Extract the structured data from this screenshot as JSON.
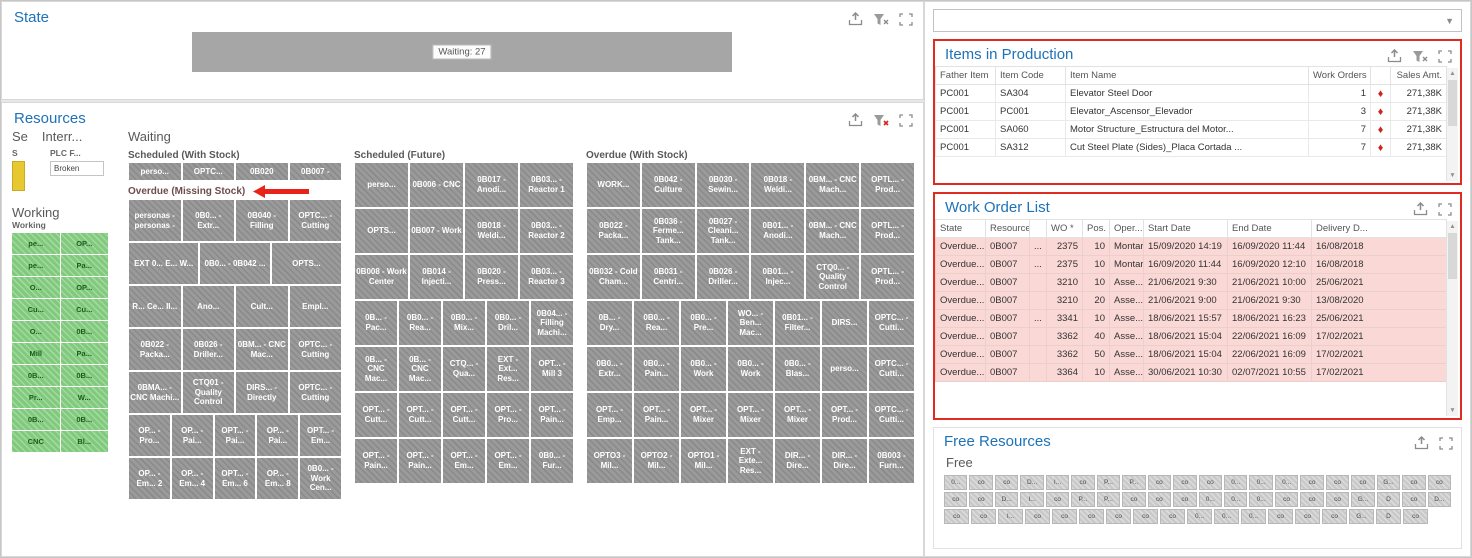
{
  "icons": {
    "export": "export-icon",
    "clear_filter": "clear-filter-icon",
    "maximize": "maximize-icon",
    "dropdown_caret": "chevron-down-icon",
    "diamond": "diamond-icon",
    "annotation_arrow": "red-arrow-icon",
    "scroll_up": "scroll-up-icon",
    "scroll_down": "scroll-down-icon"
  },
  "colors": {
    "title_blue": "#1d72b8",
    "highlight_red": "#e02b20",
    "tile_gray": "#9a9a9a",
    "tile_green": "#7fca7c",
    "tile_green_text": "#1f5c1f",
    "row_pink": "#f9d8d6",
    "diamond_red": "#cf2518",
    "bar_gray": "#a6a6a6",
    "broken_yellow": "#e5c832",
    "free_tile_gray": "#c9c9c9",
    "arrow_red": "#e8241a",
    "overdue_header": "#6d4c4c"
  },
  "state_panel": {
    "title": "State",
    "bar_label": "Waiting: 27"
  },
  "resources_panel": {
    "title": "Resources",
    "sections": {
      "setup": "Se",
      "interrupted": "Interr...",
      "waiting": "Waiting",
      "working": "Working"
    },
    "setup_group": {
      "header": "S"
    },
    "interrupted_group": {
      "header": "PLC F...",
      "tile": "Broken"
    },
    "working_group": {
      "header": "Working",
      "rows": [
        [
          "pe...",
          "OP..."
        ],
        [
          "pe...",
          "Pa..."
        ],
        [
          "O...",
          "OP..."
        ],
        [
          "Cu...",
          "Cu..."
        ],
        [
          "O...",
          "0B..."
        ],
        [
          "Mill",
          "Pa..."
        ],
        [
          "0B...",
          "0B..."
        ],
        [
          "Pr...",
          "W..."
        ],
        [
          "0B...",
          "0B..."
        ],
        [
          "CNC",
          "Bl..."
        ]
      ]
    },
    "groups": [
      {
        "name": "Scheduled (With Stock)",
        "col": 0,
        "rows": [
          [
            "perso...",
            "OPTC...",
            "0B020",
            "0B007 -"
          ]
        ]
      },
      {
        "name": "Overdue (Missing Stock)",
        "col": 0,
        "arrow": true,
        "rows": [
          [
            "personas - personas -",
            "0B0... - Extr...",
            "0B040 - Filling",
            "OPTC... - Cutting"
          ],
          [
            "EXT 0... E... W...",
            "0B0... - 0B042 ...",
            "OPTS..."
          ],
          [
            "R... Ce... II...",
            "Ano...",
            "Cult...",
            "Empl..."
          ],
          [
            "0B022 - Packa...",
            "0B026 - Driller...",
            "0BM... - CNC Mac...",
            "OPTC... - Cutting"
          ],
          [
            "0BMA... - CNC Machi...",
            "CTQ01 - Quality Control",
            "DIRS... - Directly",
            "OPTC... - Cutting"
          ],
          [
            "OP... - Pro...",
            "OP... - Pai...",
            "OPT... - Pai...",
            "OP... - Pai...",
            "OPT... - Em..."
          ],
          [
            "OP... - Em... 2",
            "OP... - Em... 4",
            "OPT... - Em... 6",
            "OP... - Em... 8",
            "0B0... - Work Cen..."
          ]
        ]
      },
      {
        "name": "Scheduled (Future)",
        "col": 1,
        "rows": [
          [
            "perso...",
            "0B006 - CNC",
            "0B017 - Anodi...",
            "0B03... - Reactor 1"
          ],
          [
            "OPTS...",
            "0B007 - Work",
            "0B018 - Weldi...",
            "0B03... - Reactor 2"
          ],
          [
            "0B008 - Work Center",
            "0B014 - Injecti...",
            "0B020 - Press...",
            "0B03... - Reactor 3"
          ],
          [
            "0B... - Pac...",
            "0B0... - Rea...",
            "0B0... - Mix...",
            "0B0... - Dril...",
            "0B04... - Filling Machi..."
          ],
          [
            "0B... - CNC Mac...",
            "0B... - CNC Mac...",
            "CTQ... - Qua...",
            "EXT - Ext... Res...",
            "OPT... - Mill 3"
          ],
          [
            "OPT... - Cutt...",
            "OPT... - Cutt...",
            "OPT... - Cutt...",
            "OPT... - Pro...",
            "OPT... - Pain..."
          ],
          [
            "OPT... - Pain...",
            "OPT... - Pain...",
            "OPT... - Em...",
            "OPT... - Em...",
            "0B0... - Fur..."
          ]
        ]
      },
      {
        "name": "Overdue (With Stock)",
        "col": 2,
        "rows": [
          [
            "WORK...",
            "0B042 - Culture",
            "0B030 - Sewin...",
            "0B018 - Weldi...",
            "0BM... - CNC Mach...",
            "OPTL... - Prod..."
          ],
          [
            "0B022 - Packa...",
            "0B036 - Ferme... Tank...",
            "0B027 - Cleani... Tank...",
            "0B01... - Anodi...",
            "0BM... - CNC Mach...",
            "OPTL... - Prod..."
          ],
          [
            "0B032 - Cold Cham...",
            "0B031 - Centri...",
            "0B026 - Driller...",
            "0B01... - Injec...",
            "CTQ0... - Quality Control",
            "OPTL... - Prod..."
          ],
          [
            "0B... - Dry...",
            "0B0... - Rea...",
            "0B0... - Pre...",
            "WO... - Ben... Mac...",
            "0B01... - Filter...",
            "DIRS...",
            "OPTC... - Cutti..."
          ],
          [
            "0B0... - Extr...",
            "0B0... - Pain...",
            "0B0... - Work",
            "0B0... - Work",
            "0B0... - Blas...",
            "perso...",
            "OPTC... - Cutti..."
          ],
          [
            "OPT... - Emp...",
            "OPT... - Pain...",
            "OPT... - Mixer",
            "OPT... - Mixer",
            "OPT... - Mixer",
            "OPT... - Prod...",
            "OPTC... - Cutti..."
          ],
          [
            "OPTO3 - Mil...",
            "OPTO2 - Mil...",
            "OPTO1 - Mil...",
            "EXT - Exte... Res...",
            "DIR... - Dire...",
            "DIR... - Dire...",
            "0B003 - Furn..."
          ]
        ]
      }
    ]
  },
  "filter_combo": {
    "value": ""
  },
  "items_panel": {
    "title": "Items in Production",
    "columns": [
      "Father Item",
      "Item Code",
      "Item Name",
      "Work Orders",
      "",
      "Sales Amt."
    ],
    "rows": [
      [
        "PC001",
        "SA304",
        "Elevator Steel Door",
        "1",
        "♦",
        "271,38K"
      ],
      [
        "PC001",
        "PC001",
        "Elevator_Ascensor_Elevador",
        "3",
        "♦",
        "271,38K"
      ],
      [
        "PC001",
        "SA060",
        "Motor Structure_Estructura del Motor...",
        "7",
        "♦",
        "271,38K"
      ],
      [
        "PC001",
        "SA312",
        "Cut Steel Plate (Sides)_Placa Cortada ...",
        "7",
        "♦",
        "271,38K"
      ]
    ]
  },
  "work_order_panel": {
    "title": "Work Order List",
    "columns": [
      "State",
      "Resource",
      "",
      "WO *",
      "Pos.",
      "Oper...",
      "Start Date",
      "End Date",
      "Delivery D..."
    ],
    "rows": [
      [
        "Overdue...",
        "0B007",
        "...",
        "2375",
        "10",
        "Montar",
        "15/09/2020 14:19",
        "16/09/2020 11:44",
        "16/08/2018"
      ],
      [
        "Overdue...",
        "0B007",
        "...",
        "2375",
        "10",
        "Montar",
        "16/09/2020 11:44",
        "16/09/2020 12:10",
        "16/08/2018"
      ],
      [
        "Overdue...",
        "0B007",
        "",
        "3210",
        "10",
        "Asse...",
        "21/06/2021 9:30",
        "21/06/2021 10:00",
        "25/06/2021"
      ],
      [
        "Overdue...",
        "0B007",
        "",
        "3210",
        "20",
        "Asse...",
        "21/06/2021 9:00",
        "21/06/2021 9:30",
        "13/08/2020"
      ],
      [
        "Overdue...",
        "0B007",
        "...",
        "3341",
        "10",
        "Asse...",
        "18/06/2021 15:57",
        "18/06/2021 16:23",
        "25/06/2021"
      ],
      [
        "Overdue...",
        "0B007",
        "",
        "3362",
        "40",
        "Asse...",
        "18/06/2021 15:04",
        "22/06/2021 16:09",
        "17/02/2021"
      ],
      [
        "Overdue...",
        "0B007",
        "",
        "3362",
        "50",
        "Asse...",
        "18/06/2021 15:04",
        "22/06/2021 16:09",
        "17/02/2021"
      ],
      [
        "Overdue...",
        "0B007",
        "",
        "3364",
        "10",
        "Asse...",
        "30/06/2021 10:30",
        "02/07/2021 10:55",
        "17/02/2021"
      ]
    ]
  },
  "free_panel": {
    "title": "Free Resources",
    "group": "Free",
    "rows": [
      [
        "0...",
        "co",
        "co",
        "D...",
        "I...",
        "co",
        "P...",
        "P...",
        "co",
        "co",
        "co",
        "0...",
        "0...",
        "0...",
        "co",
        "co",
        "co",
        "G...",
        "co",
        "co"
      ],
      [
        "co",
        "co",
        "D...",
        "I...",
        "co",
        "P...",
        "P...",
        "co",
        "co",
        "co",
        "0...",
        "0...",
        "0...",
        "co",
        "co",
        "co",
        "G...",
        "D",
        "co",
        "D..."
      ],
      [
        "co",
        "co",
        "I...",
        "co",
        "co",
        "co",
        "co",
        "co",
        "co",
        "0...",
        "0...",
        "0...",
        "co",
        "co",
        "co",
        "G...",
        "D",
        "co"
      ]
    ]
  }
}
